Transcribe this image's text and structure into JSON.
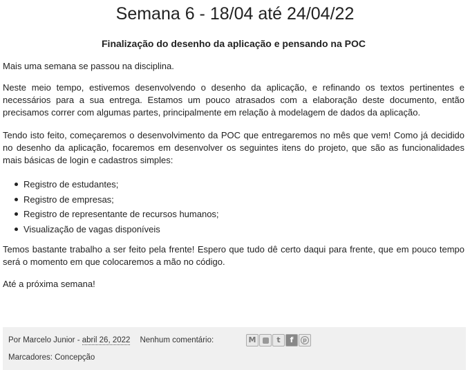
{
  "post": {
    "title": "Semana 6 - 18/04 até 24/04/22",
    "subtitle": "Finalização do desenho da aplicação e pensando na POC",
    "paragraphs": [
      "Mais uma semana se passou na disciplina.",
      "Neste meio tempo, estivemos desenvolvendo o desenho da aplicação, e refinando os textos pertinentes e necessários para a sua entrega. Estamos um pouco atrasados com a elaboração deste documento, então precisamos correr com algumas partes, principalmente em relação à modelagem de dados da aplicação.",
      "Tendo isto feito, começaremos o desenvolvimento da POC que entregaremos no mês que vem! Como já decidido no desenho da aplicação, focaremos em desenvolver os seguintes itens do projeto, que são as funcionalidades mais básicas de login e cadastros simples:",
      "Temos bastante trabalho a ser feito pela frente! Espero que tudo dê certo daqui para frente, que em pouco tempo será o momento em que colocaremos a mão no código.",
      "Até a próxima semana!"
    ],
    "list_items": [
      "Registro de estudantes;",
      "Registro de empresas;",
      "Registro de representante de recursos humanos;",
      "Visualização de vagas disponíveis"
    ]
  },
  "footer": {
    "author_prefix": "Por Marcelo Junior - ",
    "date": "abril 26, 2022",
    "comments": "Nenhum comentário:",
    "labels_prefix": "Marcadores: ",
    "label": "Concepção",
    "share_icons": [
      "email-icon",
      "blogger-icon",
      "twitter-icon",
      "facebook-icon",
      "pinterest-icon"
    ]
  }
}
